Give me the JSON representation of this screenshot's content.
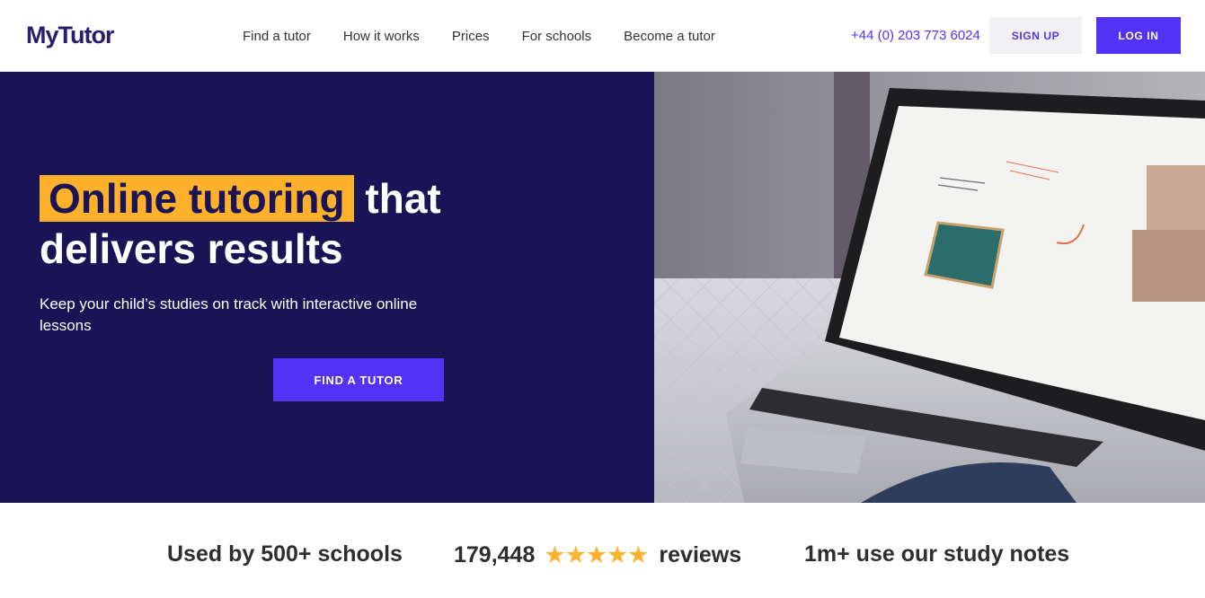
{
  "header": {
    "logo": "MyTutor",
    "nav": [
      "Find a tutor",
      "How it works",
      "Prices",
      "For schools",
      "Become a tutor"
    ],
    "phone": "+44 (0) 203 773 6024",
    "signup_label": "SIGN UP",
    "login_label": "LOG IN"
  },
  "hero": {
    "title_highlight": "Online tutoring",
    "title_rest": " that delivers results",
    "subtitle": "Keep your child’s studies on track with interactive online lessons",
    "cta_label": "FIND A TUTOR"
  },
  "stats": {
    "schools": "Used by 500+ schools",
    "reviews_count": "179,448",
    "stars": "★★★★★",
    "reviews_label": "reviews",
    "notes": "1m+ use our study notes"
  },
  "colors": {
    "brand": "#5233f6",
    "hero_bg": "#1a1457",
    "highlight": "#ffb12b"
  }
}
